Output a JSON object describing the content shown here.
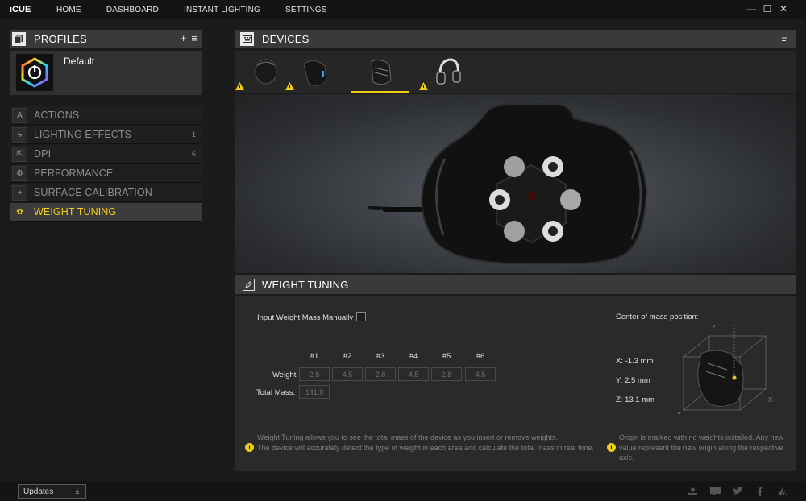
{
  "app": {
    "title": "iCUE"
  },
  "nav": {
    "items": [
      "HOME",
      "DASHBOARD",
      "INSTANT LIGHTING",
      "SETTINGS"
    ]
  },
  "window_controls": {
    "minimize": "—",
    "maximize": "☐",
    "close": "✕"
  },
  "profiles": {
    "title": "PROFILES",
    "add": "+",
    "menu": "≡",
    "default_name": "Default"
  },
  "menu": {
    "items": [
      {
        "label": "ACTIONS",
        "count": "",
        "icon": "A"
      },
      {
        "label": "LIGHTING EFFECTS",
        "count": "1",
        "icon": "ϟ"
      },
      {
        "label": "DPI",
        "count": "6",
        "icon": "⇱"
      },
      {
        "label": "PERFORMANCE",
        "count": "",
        "icon": "⚙"
      },
      {
        "label": "SURFACE CALIBRATION",
        "count": "",
        "icon": "⌖"
      },
      {
        "label": "WEIGHT TUNING",
        "count": "",
        "icon": "✿"
      }
    ],
    "active_index": 5
  },
  "devices": {
    "title": "DEVICES",
    "selected_index": 2
  },
  "weight_tuning": {
    "title": "WEIGHT TUNING",
    "manual_label": "Input Weight Mass Manually",
    "columns": [
      "#1",
      "#2",
      "#3",
      "#4",
      "#5",
      "#6"
    ],
    "weight_label": "Weight",
    "weights": [
      "2.8",
      "4.5",
      "2.8",
      "4.5",
      "2.8",
      "4.5"
    ],
    "total_label": "Total Mass:",
    "total": "141.9",
    "info_left": "Weight Tuning allows you to see the total mass of the device as you insert or remove weights.\nThe device will accurately detect the type of weight in each area and calculate the total mass in real time.",
    "com_title": "Center of mass position:",
    "com_x": "X:   -1.3 mm",
    "com_y": "Y:    2.5 mm",
    "com_z": "Z:  13.1 mm",
    "axis_x": "X",
    "axis_y": "Y",
    "axis_z": "Z",
    "info_right": "Origin is marked with no weights installed. Any new value represent the new origin along the respective axis."
  },
  "bottom": {
    "updates_label": "Updates"
  },
  "colors": {
    "accent": "#f0cc1b",
    "panel": "#3a3a3c",
    "background": "#1b1b1c"
  }
}
